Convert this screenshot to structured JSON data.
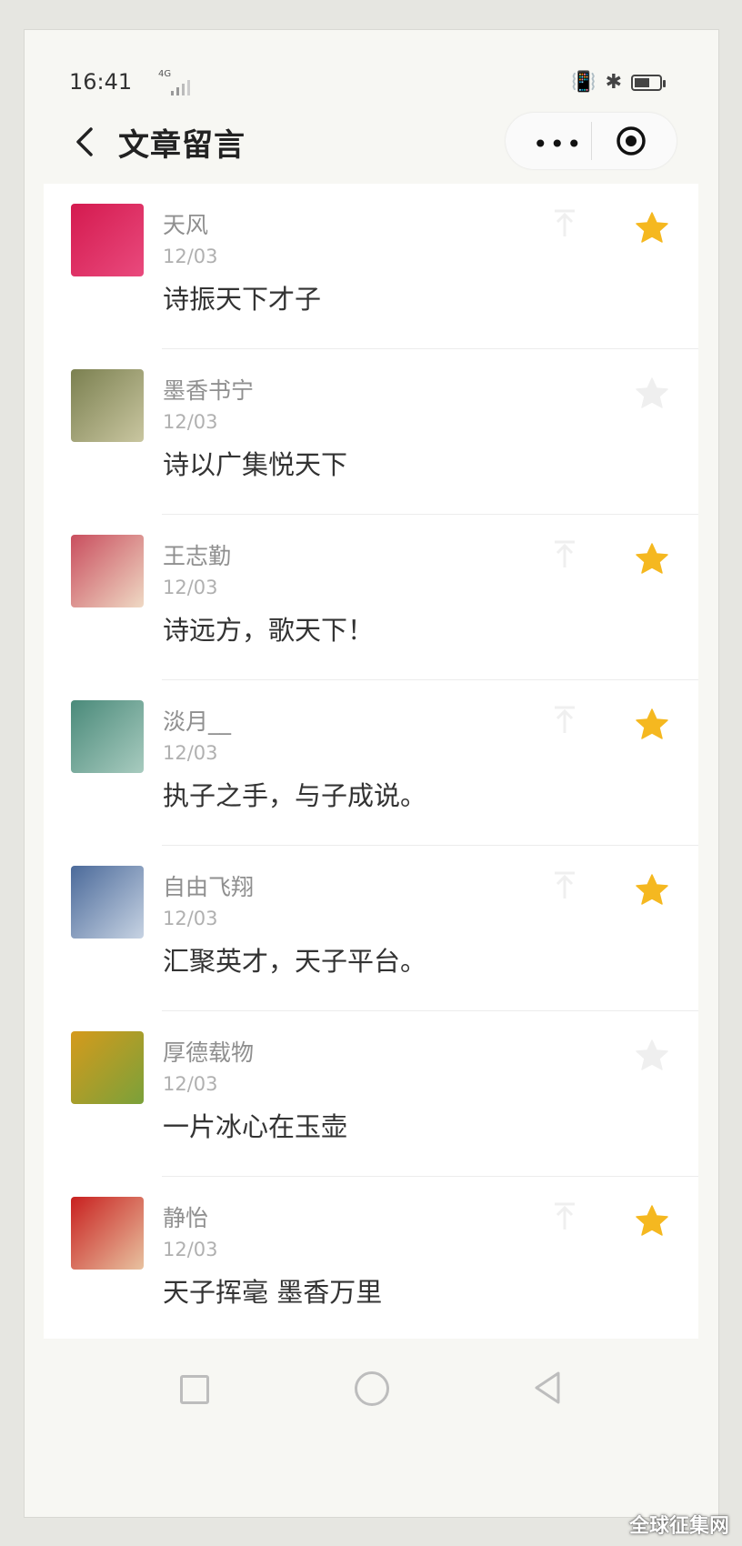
{
  "status_bar": {
    "time": "16:41",
    "network": "4G",
    "battery_level": 0.6
  },
  "header": {
    "title": "文章留言",
    "more_label": "•••"
  },
  "comments": [
    {
      "name": "天风",
      "date": "12/03",
      "text": "诗振天下才子",
      "starred": true,
      "pinned": true,
      "avatar_colors": [
        "#d41a4f",
        "#e94a7d"
      ]
    },
    {
      "name": "墨香书宁",
      "date": "12/03",
      "text": "诗以广集悦天下",
      "starred": false,
      "pinned": false,
      "avatar_colors": [
        "#7b8050",
        "#c9c6a0"
      ]
    },
    {
      "name": "王志勤",
      "date": "12/03",
      "text": "诗远方，歌天下！",
      "starred": true,
      "pinned": true,
      "avatar_colors": [
        "#c94e5e",
        "#efd9c4"
      ]
    },
    {
      "name": "淡月__",
      "date": "12/03",
      "text": "执子之手，与子成说。",
      "starred": true,
      "pinned": true,
      "avatar_colors": [
        "#4a8a7a",
        "#a8cbbf"
      ]
    },
    {
      "name": "自由飞翔",
      "date": "12/03",
      "text": "汇聚英才，天子平台。",
      "starred": true,
      "pinned": true,
      "avatar_colors": [
        "#4b6a9a",
        "#c7d3e3"
      ]
    },
    {
      "name": "厚德载物",
      "date": "12/03",
      "text": "一片冰心在玉壶",
      "starred": false,
      "pinned": false,
      "avatar_colors": [
        "#d59a1c",
        "#7aa13a"
      ]
    },
    {
      "name": "静怡",
      "date": "12/03",
      "text": "天子挥毫 墨香万里",
      "starred": true,
      "pinned": true,
      "avatar_colors": [
        "#c8201f",
        "#e8c2a0"
      ]
    }
  ],
  "colors": {
    "star_active": "#f5b820",
    "star_inactive": "#efefef",
    "pin_icon": "#efefef"
  },
  "watermark": "全球征集网"
}
